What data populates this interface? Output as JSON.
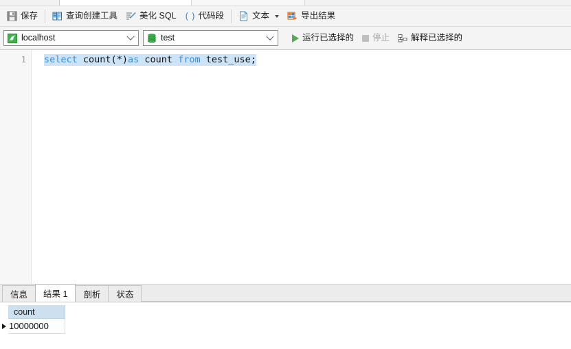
{
  "window": {
    "app_kind": "sql-editor"
  },
  "toolbar": {
    "items": [
      {
        "label": "保存",
        "icon": "save-floppy-icon"
      },
      {
        "label": "查询创建工具",
        "icon": "query-builder-icon"
      },
      {
        "label": "美化 SQL",
        "icon": "beautify-sql-icon"
      },
      {
        "label": "代码段",
        "icon": "code-snippet-parens-icon"
      },
      {
        "label": "文本",
        "icon": "text-document-icon"
      },
      {
        "label": "导出结果",
        "icon": "export-result-icon"
      }
    ]
  },
  "connection_bar": {
    "host": {
      "value": "localhost",
      "icon": "server-connection-icon"
    },
    "database": {
      "value": "test",
      "icon": "database-cylinder-icon"
    },
    "run_selected": {
      "label": "运行已选择的",
      "icon": "play-triangle-icon"
    },
    "stop": {
      "label": "停止",
      "icon": "stop-square-icon",
      "disabled": true
    },
    "explain_selected": {
      "label": "解释已选择的",
      "icon": "explain-plan-icon"
    }
  },
  "editor": {
    "line_number": "1",
    "sql_tokens": [
      {
        "t": "select",
        "type": "keyword"
      },
      {
        "t": " ",
        "type": "plain"
      },
      {
        "t": "count(*)",
        "type": "plain"
      },
      {
        "t": "as",
        "type": "keyword"
      },
      {
        "t": " count ",
        "type": "plain"
      },
      {
        "t": "from",
        "type": "keyword"
      },
      {
        "t": " test_use;",
        "type": "plain"
      }
    ],
    "sql_full": "select count(*)as count from test_use;"
  },
  "bottom_tabs": {
    "items": [
      {
        "label": "信息",
        "active": false
      },
      {
        "label": "结果 1",
        "active": true
      },
      {
        "label": "剖析",
        "active": false
      },
      {
        "label": "状态",
        "active": false
      }
    ]
  },
  "result_grid": {
    "columns": [
      "count"
    ],
    "rows": [
      {
        "cells": [
          "10000000"
        ],
        "current": true
      }
    ]
  },
  "colors": {
    "keyword": "#3b8ede",
    "selection": "#cde3f8",
    "header_fill": "#cde0f0",
    "run_green": "#57a957",
    "chrome": "#f4f4f4"
  }
}
